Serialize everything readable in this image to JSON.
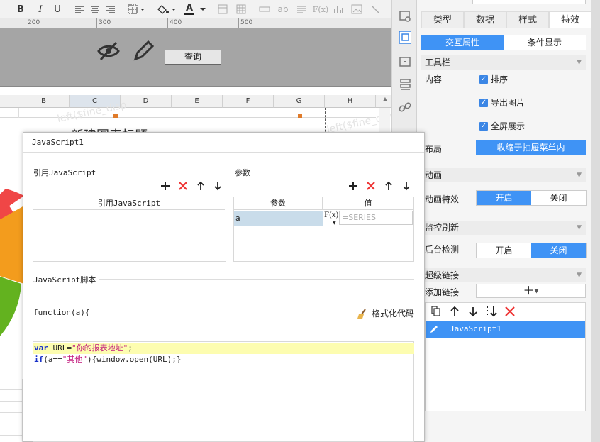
{
  "toolbar": {
    "bold": "B",
    "italic": "I",
    "underline": "U",
    "font_color_label": "A",
    "ab_label": "ab",
    "fx_label": "F(x)"
  },
  "ruler": {
    "ticks": [
      "200",
      "300",
      "400",
      "500"
    ]
  },
  "param_pane": {
    "query_button": "查询"
  },
  "sheet": {
    "columns": [
      "B",
      "C",
      "D",
      "E",
      "F",
      "G",
      "H"
    ],
    "title_partial": "新建图表标题",
    "watermark": "left($fine_disp"
  },
  "right_panel": {
    "tabs": [
      "类型",
      "数据",
      "样式",
      "特效"
    ],
    "active_tab": "特效",
    "subtabs": [
      "交互属性",
      "条件显示"
    ],
    "toolbar_section": "工具栏",
    "content_label": "内容",
    "checkboxes": [
      "排序",
      "导出图片",
      "全屏展示"
    ],
    "layout_label": "布局",
    "layout_value": "收缩于抽屉菜单内",
    "animation_section": "动画",
    "animation_label": "动画特效",
    "on": "开启",
    "off": "关闭",
    "monitor_section": "监控刷新",
    "monitor_label": "后台检测",
    "hyperlink_section": "超级链接",
    "add_link_label": "添加链接",
    "link_item": "JavaScript1"
  },
  "dialog": {
    "title": "JavaScript1",
    "ref_group": "引用JavaScript",
    "ref_header": "引用JavaScript",
    "param_group": "参数",
    "param_headers": [
      "参数",
      "值"
    ],
    "param_rows": [
      {
        "name": "a",
        "fx": "F(x)",
        "value_placeholder": "=SERIES"
      }
    ],
    "script_group": "JavaScript脚本",
    "function_signature": "function(a){",
    "format_button": "格式化代码",
    "code_line1_kw": "var",
    "code_line1_rest": " URL=",
    "code_line1_str": "\"你的报表地址\"",
    "code_line1_end": ";",
    "code_line2_kw": "if",
    "code_line2_a": "(a==",
    "code_line2_str": "\"其他\"",
    "code_line2_rest": "){window.open(URL);}"
  },
  "colors": {
    "accent": "#3f93f5",
    "panel_bg": "#f5f5f5",
    "param_bg": "#a5a5a5",
    "code_highlight": "#fdfdb0",
    "delete_red": "#ee3333"
  }
}
